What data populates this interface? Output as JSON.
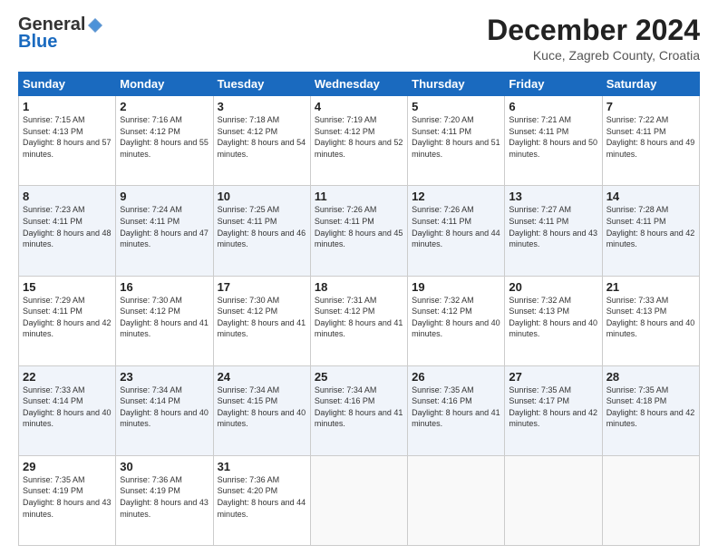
{
  "header": {
    "logo_general": "General",
    "logo_blue": "Blue",
    "title": "December 2024",
    "location": "Kuce, Zagreb County, Croatia"
  },
  "days_of_week": [
    "Sunday",
    "Monday",
    "Tuesday",
    "Wednesday",
    "Thursday",
    "Friday",
    "Saturday"
  ],
  "weeks": [
    [
      {
        "day": "1",
        "sunrise": "7:15 AM",
        "sunset": "4:13 PM",
        "daylight": "8 hours and 57 minutes."
      },
      {
        "day": "2",
        "sunrise": "7:16 AM",
        "sunset": "4:12 PM",
        "daylight": "8 hours and 55 minutes."
      },
      {
        "day": "3",
        "sunrise": "7:18 AM",
        "sunset": "4:12 PM",
        "daylight": "8 hours and 54 minutes."
      },
      {
        "day": "4",
        "sunrise": "7:19 AM",
        "sunset": "4:12 PM",
        "daylight": "8 hours and 52 minutes."
      },
      {
        "day": "5",
        "sunrise": "7:20 AM",
        "sunset": "4:11 PM",
        "daylight": "8 hours and 51 minutes."
      },
      {
        "day": "6",
        "sunrise": "7:21 AM",
        "sunset": "4:11 PM",
        "daylight": "8 hours and 50 minutes."
      },
      {
        "day": "7",
        "sunrise": "7:22 AM",
        "sunset": "4:11 PM",
        "daylight": "8 hours and 49 minutes."
      }
    ],
    [
      {
        "day": "8",
        "sunrise": "7:23 AM",
        "sunset": "4:11 PM",
        "daylight": "8 hours and 48 minutes."
      },
      {
        "day": "9",
        "sunrise": "7:24 AM",
        "sunset": "4:11 PM",
        "daylight": "8 hours and 47 minutes."
      },
      {
        "day": "10",
        "sunrise": "7:25 AM",
        "sunset": "4:11 PM",
        "daylight": "8 hours and 46 minutes."
      },
      {
        "day": "11",
        "sunrise": "7:26 AM",
        "sunset": "4:11 PM",
        "daylight": "8 hours and 45 minutes."
      },
      {
        "day": "12",
        "sunrise": "7:26 AM",
        "sunset": "4:11 PM",
        "daylight": "8 hours and 44 minutes."
      },
      {
        "day": "13",
        "sunrise": "7:27 AM",
        "sunset": "4:11 PM",
        "daylight": "8 hours and 43 minutes."
      },
      {
        "day": "14",
        "sunrise": "7:28 AM",
        "sunset": "4:11 PM",
        "daylight": "8 hours and 42 minutes."
      }
    ],
    [
      {
        "day": "15",
        "sunrise": "7:29 AM",
        "sunset": "4:11 PM",
        "daylight": "8 hours and 42 minutes."
      },
      {
        "day": "16",
        "sunrise": "7:30 AM",
        "sunset": "4:12 PM",
        "daylight": "8 hours and 41 minutes."
      },
      {
        "day": "17",
        "sunrise": "7:30 AM",
        "sunset": "4:12 PM",
        "daylight": "8 hours and 41 minutes."
      },
      {
        "day": "18",
        "sunrise": "7:31 AM",
        "sunset": "4:12 PM",
        "daylight": "8 hours and 41 minutes."
      },
      {
        "day": "19",
        "sunrise": "7:32 AM",
        "sunset": "4:12 PM",
        "daylight": "8 hours and 40 minutes."
      },
      {
        "day": "20",
        "sunrise": "7:32 AM",
        "sunset": "4:13 PM",
        "daylight": "8 hours and 40 minutes."
      },
      {
        "day": "21",
        "sunrise": "7:33 AM",
        "sunset": "4:13 PM",
        "daylight": "8 hours and 40 minutes."
      }
    ],
    [
      {
        "day": "22",
        "sunrise": "7:33 AM",
        "sunset": "4:14 PM",
        "daylight": "8 hours and 40 minutes."
      },
      {
        "day": "23",
        "sunrise": "7:34 AM",
        "sunset": "4:14 PM",
        "daylight": "8 hours and 40 minutes."
      },
      {
        "day": "24",
        "sunrise": "7:34 AM",
        "sunset": "4:15 PM",
        "daylight": "8 hours and 40 minutes."
      },
      {
        "day": "25",
        "sunrise": "7:34 AM",
        "sunset": "4:16 PM",
        "daylight": "8 hours and 41 minutes."
      },
      {
        "day": "26",
        "sunrise": "7:35 AM",
        "sunset": "4:16 PM",
        "daylight": "8 hours and 41 minutes."
      },
      {
        "day": "27",
        "sunrise": "7:35 AM",
        "sunset": "4:17 PM",
        "daylight": "8 hours and 42 minutes."
      },
      {
        "day": "28",
        "sunrise": "7:35 AM",
        "sunset": "4:18 PM",
        "daylight": "8 hours and 42 minutes."
      }
    ],
    [
      {
        "day": "29",
        "sunrise": "7:35 AM",
        "sunset": "4:19 PM",
        "daylight": "8 hours and 43 minutes."
      },
      {
        "day": "30",
        "sunrise": "7:36 AM",
        "sunset": "4:19 PM",
        "daylight": "8 hours and 43 minutes."
      },
      {
        "day": "31",
        "sunrise": "7:36 AM",
        "sunset": "4:20 PM",
        "daylight": "8 hours and 44 minutes."
      },
      null,
      null,
      null,
      null
    ]
  ]
}
